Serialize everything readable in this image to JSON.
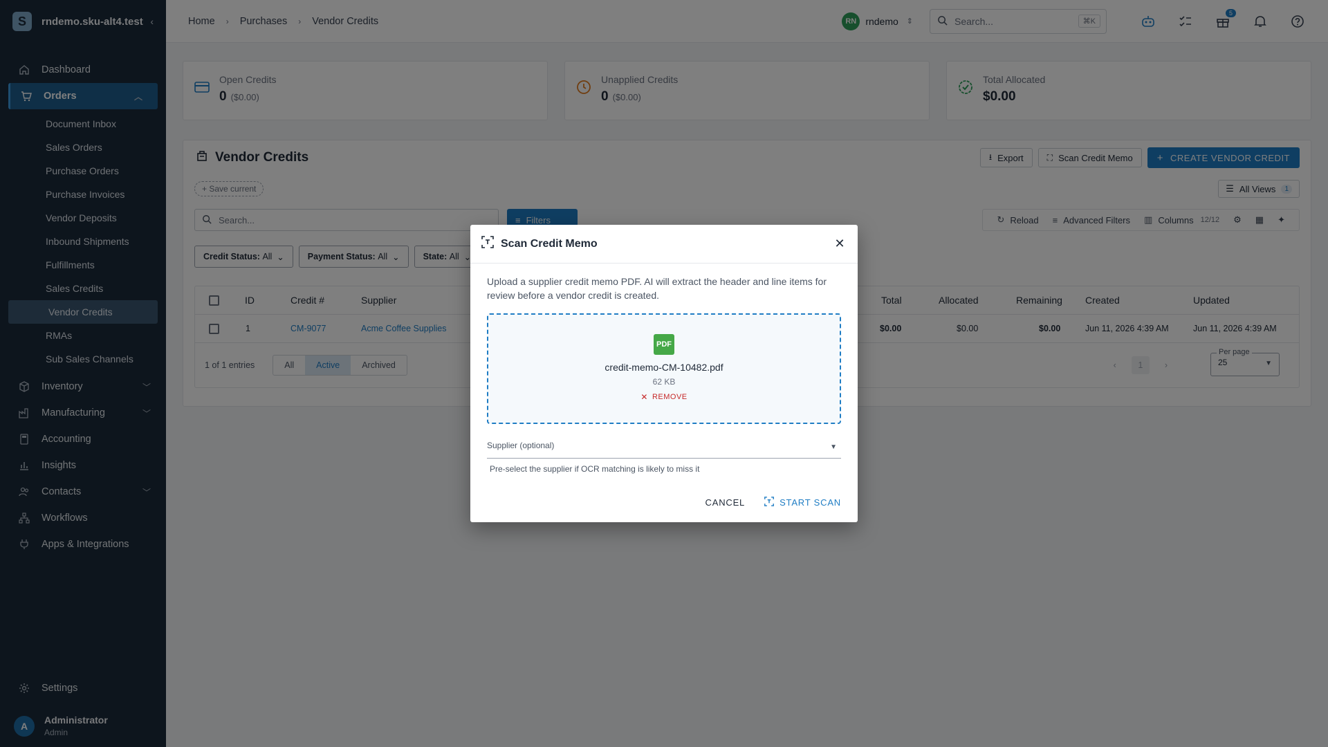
{
  "sidebar": {
    "brand": "rndemo.sku-alt4.test",
    "nav": [
      {
        "label": "Dashboard"
      },
      {
        "label": "Orders"
      },
      {
        "label": "Inventory"
      },
      {
        "label": "Manufacturing"
      },
      {
        "label": "Accounting"
      },
      {
        "label": "Insights"
      },
      {
        "label": "Contacts"
      },
      {
        "label": "Workflows"
      },
      {
        "label": "Apps & Integrations"
      }
    ],
    "orders_sub": [
      "Document Inbox",
      "Sales Orders",
      "Purchase Orders",
      "Purchase Invoices",
      "Vendor Deposits",
      "Inbound Shipments",
      "Fulfillments",
      "Sales Credits",
      "Vendor Credits",
      "RMAs",
      "Sub Sales Channels"
    ],
    "settings": "Settings",
    "user": {
      "initial": "A",
      "name": "Administrator",
      "role": "Admin"
    }
  },
  "topbar": {
    "breadcrumb": [
      "Home",
      "Purchases",
      "Vendor Credits"
    ],
    "user_initials": "RN",
    "user_name": "rndemo",
    "search_placeholder": "Search...",
    "search_shortcut": "⌘K",
    "gift_badge": "5"
  },
  "stats": [
    {
      "label": "Open Credits",
      "value": "0",
      "sub": "($0.00)"
    },
    {
      "label": "Unapplied Credits",
      "value": "0",
      "sub": "($0.00)"
    },
    {
      "label": "Total Allocated",
      "value": "$0.00",
      "sub": ""
    }
  ],
  "panel": {
    "title": "Vendor Credits",
    "export": "Export",
    "scan": "Scan Credit Memo",
    "create": "CREATE VENDOR CREDIT",
    "save_current": "Save current",
    "all_views": "All Views",
    "all_views_count": "1",
    "search_placeholder": "Search...",
    "filters": "Filters",
    "reload": "Reload",
    "advanced_filters": "Advanced Filters",
    "columns": "Columns",
    "columns_count": "12/12",
    "chips": [
      {
        "label": "Credit Status:",
        "value": "All"
      },
      {
        "label": "Payment Status:",
        "value": "All"
      },
      {
        "label": "State:",
        "value": "All"
      }
    ],
    "columns_headers": {
      "id": "ID",
      "credit": "Credit #",
      "supplier": "Supplier",
      "total": "Total",
      "allocated": "Allocated",
      "remaining": "Remaining",
      "created": "Created",
      "updated": "Updated"
    },
    "row": {
      "id": "1",
      "credit": "CM-9077",
      "supplier": "Acme Coffee Supplies",
      "total": "$0.00",
      "allocated": "$0.00",
      "remaining": "$0.00",
      "created": "Jun 11, 2026 4:39 AM",
      "updated": "Jun 11, 2026 4:39 AM"
    },
    "entries": "1 of 1 entries",
    "seg": [
      "All",
      "Active",
      "Archived"
    ],
    "page": "1",
    "per_page_label": "Per page",
    "per_page": "25"
  },
  "modal": {
    "title": "Scan Credit Memo",
    "description": "Upload a supplier credit memo PDF. AI will extract the header and line items for review before a vendor credit is created.",
    "file_type": "PDF",
    "file_name": "credit-memo-CM-10482.pdf",
    "file_size": "62 KB",
    "remove": "REMOVE",
    "supplier_label": "Supplier (optional)",
    "helper": "Pre-select the supplier if OCR matching is likely to miss it",
    "cancel": "CANCEL",
    "start": "START SCAN"
  },
  "colors": {
    "accent": "#1f7dc4",
    "sidebar": "#1b2a3a",
    "pdf": "#45a847",
    "danger": "#c62828"
  }
}
